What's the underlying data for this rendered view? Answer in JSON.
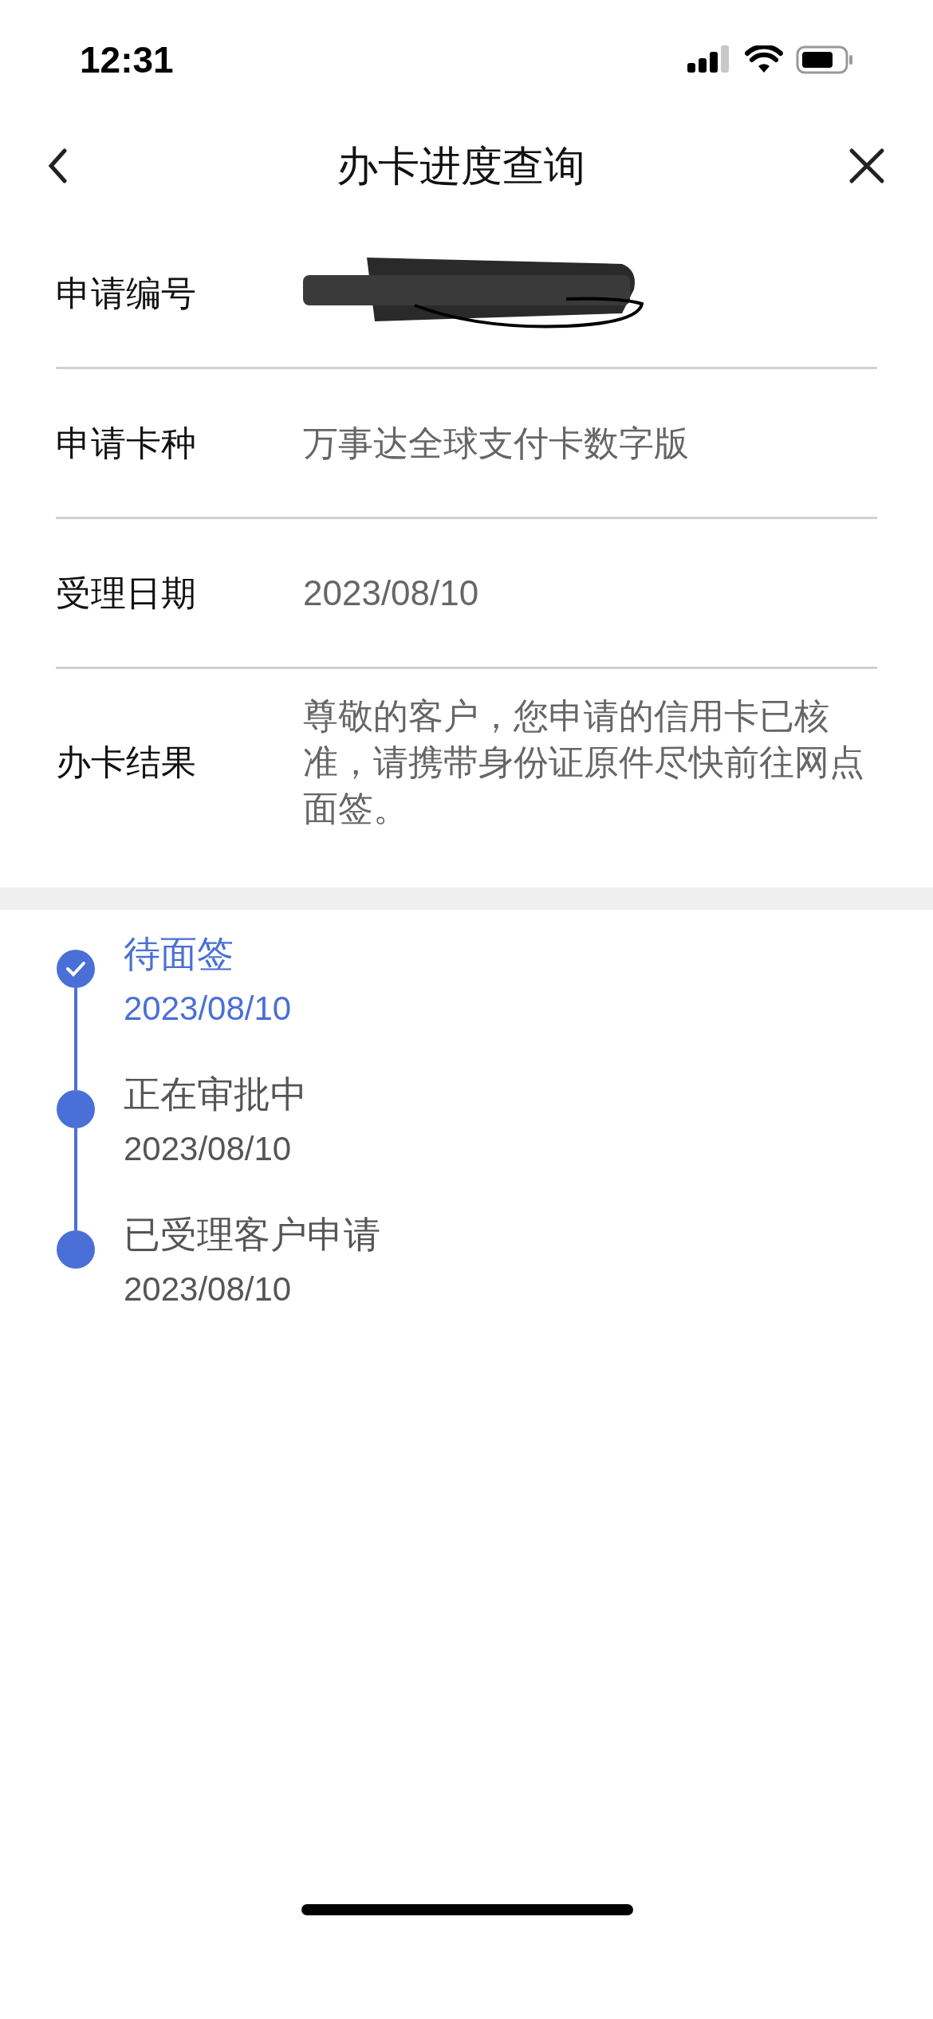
{
  "status_bar": {
    "time": "12:31"
  },
  "header": {
    "title": "办卡进度查询"
  },
  "details": [
    {
      "label": "申请编号",
      "kind": "redacted"
    },
    {
      "label": "申请卡种",
      "kind": "text",
      "value": "万事达全球支付卡数字版"
    },
    {
      "label": "受理日期",
      "kind": "text",
      "value": "2023/08/10"
    },
    {
      "label": "办卡结果",
      "kind": "text",
      "value": "尊敬的客户，您申请的信用卡已核准，请携带身份证原件尽快前往网点面签。"
    }
  ],
  "timeline": [
    {
      "title": "待面签",
      "date": "2023/08/10",
      "current": true
    },
    {
      "title": "正在审批中",
      "date": "2023/08/10",
      "current": false
    },
    {
      "title": "已受理客户申请",
      "date": "2023/08/10",
      "current": false
    }
  ]
}
